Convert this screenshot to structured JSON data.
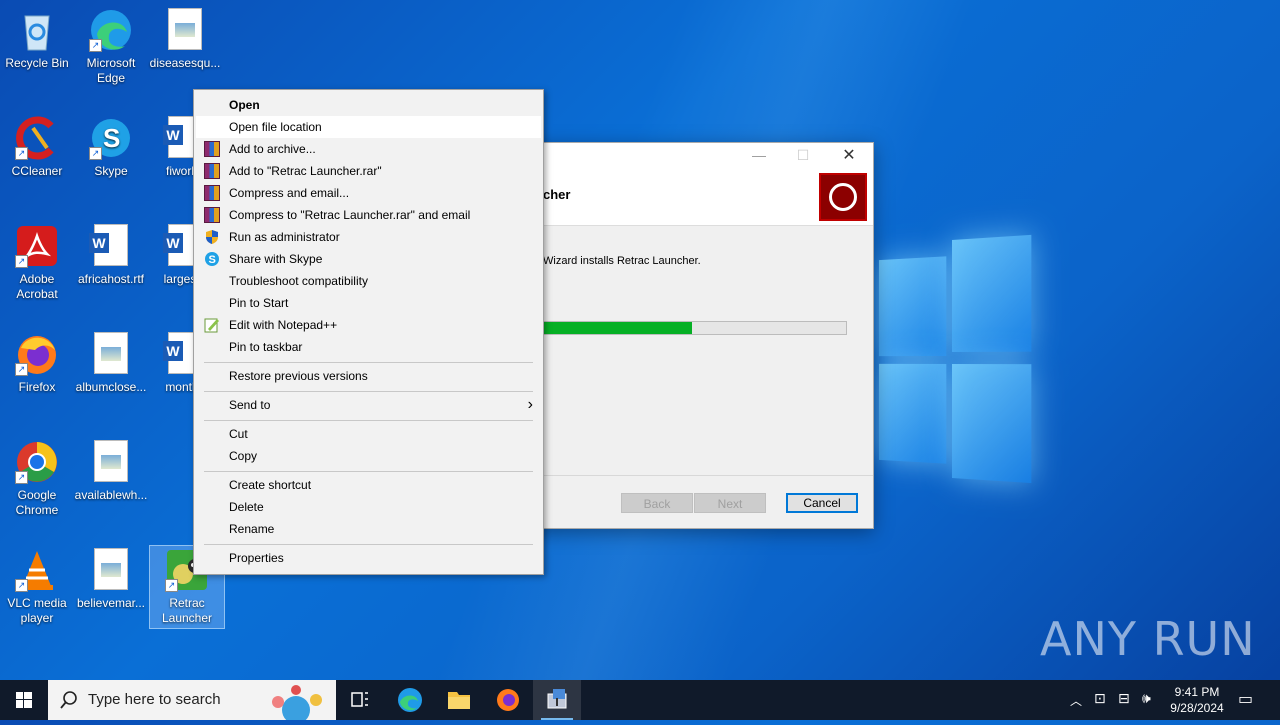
{
  "desktop": {
    "icons": [
      {
        "label": "Recycle Bin",
        "icon": "recycle-bin-icon"
      },
      {
        "label": "Microsoft Edge",
        "icon": "edge-icon"
      },
      {
        "label": "diseasesqu...",
        "icon": "image-file-icon"
      },
      {
        "label": "CCleaner",
        "icon": "ccleaner-icon"
      },
      {
        "label": "Skype",
        "icon": "skype-icon"
      },
      {
        "label": "fiworke",
        "icon": "word-doc-icon"
      },
      {
        "label": "Adobe Acrobat",
        "icon": "acrobat-icon"
      },
      {
        "label": "africahost.rtf",
        "icon": "word-doc-icon"
      },
      {
        "label": "largesat",
        "icon": "word-doc-icon"
      },
      {
        "label": "Firefox",
        "icon": "firefox-icon"
      },
      {
        "label": "albumclose...",
        "icon": "image-file-icon"
      },
      {
        "label": "months",
        "icon": "word-doc-icon"
      },
      {
        "label": "Google Chrome",
        "icon": "chrome-icon"
      },
      {
        "label": "availablewh...",
        "icon": "image-file-icon"
      },
      {
        "label": "VLC media player",
        "icon": "vlc-icon"
      },
      {
        "label": "believemar...",
        "icon": "image-file-icon"
      },
      {
        "label": "Retrac Launcher",
        "icon": "retrac-launcher-icon"
      }
    ]
  },
  "installer": {
    "heading": "cher",
    "description": "Wizard installs Retrac Launcher.",
    "progress_fraction": 0.49,
    "buttons": {
      "back": "Back",
      "next": "Next",
      "cancel": "Cancel"
    },
    "colors": {
      "progress": "#06b025",
      "logo_bg": "#8c0000"
    }
  },
  "context_menu": {
    "items": [
      {
        "label": "Open",
        "bold": true
      },
      {
        "label": "Open file location",
        "hover": true
      },
      {
        "label": "Add to archive...",
        "icon": "winrar-icon"
      },
      {
        "label": "Add to \"Retrac Launcher.rar\"",
        "icon": "winrar-icon"
      },
      {
        "label": "Compress and email...",
        "icon": "winrar-icon"
      },
      {
        "label": "Compress to \"Retrac Launcher.rar\" and email",
        "icon": "winrar-icon"
      },
      {
        "label": "Run as administrator",
        "icon": "uac-shield-icon"
      },
      {
        "label": "Share with Skype",
        "icon": "skype-icon"
      },
      {
        "label": "Troubleshoot compatibility"
      },
      {
        "label": "Pin to Start"
      },
      {
        "label": "Edit with Notepad++",
        "icon": "notepadpp-icon"
      },
      {
        "label": "Pin to taskbar"
      },
      {
        "label": "Restore previous versions"
      },
      {
        "label": "Send to",
        "submenu": true
      },
      {
        "label": "Cut"
      },
      {
        "label": "Copy"
      },
      {
        "label": "Create shortcut"
      },
      {
        "label": "Delete"
      },
      {
        "label": "Rename"
      },
      {
        "label": "Properties"
      }
    ]
  },
  "taskbar": {
    "search_placeholder": "Type here to search",
    "apps": [
      "task-view-icon",
      "edge-icon",
      "file-explorer-icon",
      "firefox-icon",
      "installer-icon"
    ],
    "clock_time": "9:41 PM",
    "clock_date": "9/28/2024"
  },
  "watermark": "ANY RUN"
}
